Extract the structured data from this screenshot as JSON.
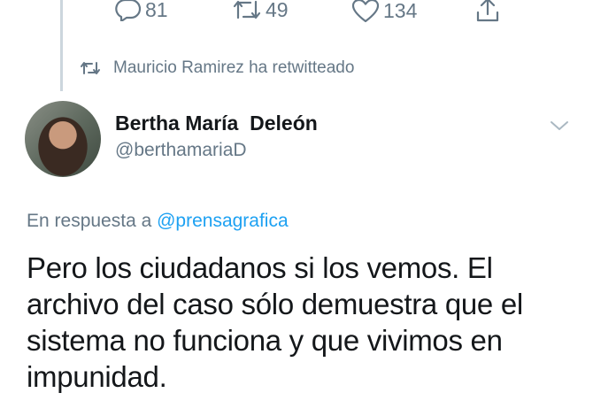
{
  "actions": {
    "reply_count": "81",
    "retweet_count": "49",
    "like_count": "134"
  },
  "retweet_notice": "Mauricio Ramirez ha retwitteado",
  "author": {
    "name": "Bertha María  Deleón",
    "handle": "@berthamariaD"
  },
  "reply_to": {
    "prefix": "En respuesta a ",
    "mention": "@prensagrafica"
  },
  "tweet_text": "Pero los ciudadanos si los vemos. El archivo del caso sólo demuestra que el sistema no funciona y que vivimos en impunidad.",
  "colors": {
    "secondary_text": "#657786",
    "link": "#1da1f2",
    "primary_text": "#14171a"
  }
}
